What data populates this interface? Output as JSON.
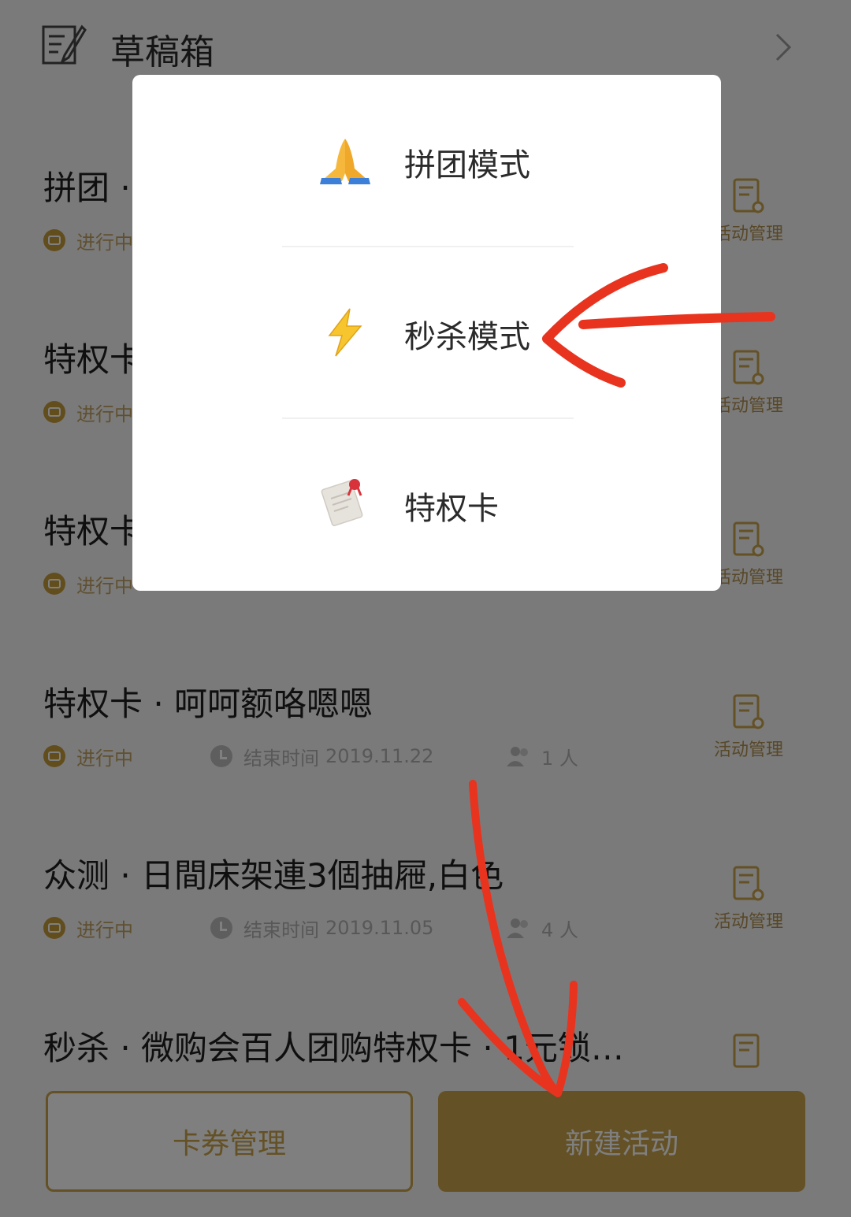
{
  "drafts": {
    "title": "草稿箱"
  },
  "activities": [
    {
      "title": "拼团 ·",
      "status": "进行中",
      "end_label": "",
      "end_date": "",
      "people": "",
      "manage_label": "活动管理"
    },
    {
      "title": "特权卡",
      "status": "进行中",
      "end_label": "",
      "end_date": "",
      "people": "",
      "manage_label": "活动管理"
    },
    {
      "title": "特权卡",
      "status": "进行中",
      "end_label": "",
      "end_date": "",
      "people": "",
      "manage_label": "活动管理"
    },
    {
      "title": "特权卡 · 呵呵额咯嗯嗯",
      "status": "进行中",
      "end_label": "结束时间",
      "end_date": "2019.11.22",
      "people": "1 人",
      "manage_label": "活动管理"
    },
    {
      "title": "众测 · 日間床架連3個抽屜,白色",
      "status": "进行中",
      "end_label": "结束时间",
      "end_date": "2019.11.05",
      "people": "4 人",
      "manage_label": "活动管理"
    },
    {
      "title": "秒杀 · 微购会百人团购特权卡 · 1元锁…",
      "status": "",
      "end_label": "",
      "end_date": "",
      "people": "",
      "manage_label": ""
    }
  ],
  "buttons": {
    "cards": "卡券管理",
    "new_activity": "新建活动"
  },
  "modal": {
    "items": [
      {
        "label": "拼团模式",
        "icon": "folded-hands-icon"
      },
      {
        "label": "秒杀模式",
        "icon": "lightning-icon"
      },
      {
        "label": "特权卡",
        "icon": "card-icon"
      }
    ]
  },
  "colors": {
    "accent": "#c9a24a",
    "annotation": "#e8331f"
  }
}
